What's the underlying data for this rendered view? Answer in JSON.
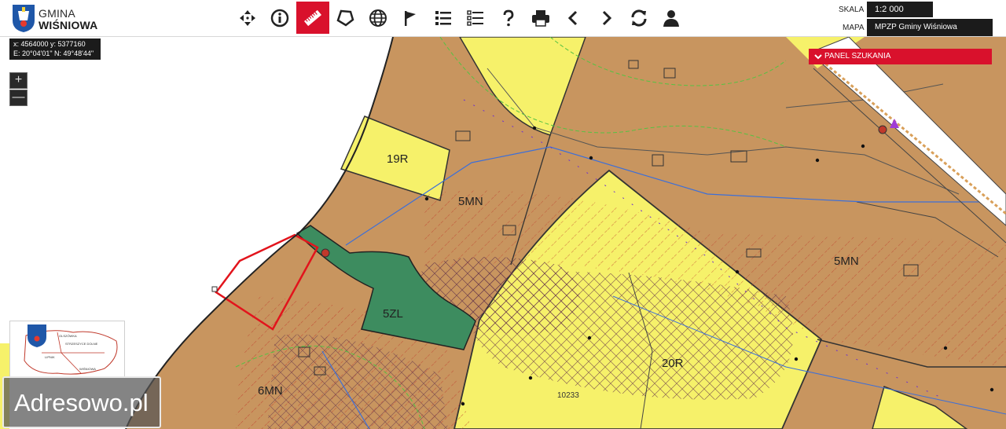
{
  "header": {
    "logo_line1": "GMINA",
    "logo_line2": "WIŚNIOWA",
    "scale_label": "SKALA",
    "scale_value": "1:2 000",
    "map_label": "MAPA",
    "map_value": "MPZP Gminy Wiśniowa"
  },
  "toolbar": {
    "tools": [
      {
        "icon": "pan-arrows-icon",
        "active": false
      },
      {
        "icon": "info-icon",
        "active": false
      },
      {
        "icon": "ruler-icon",
        "active": true
      },
      {
        "icon": "polygon-icon",
        "active": false
      },
      {
        "icon": "globe-icon",
        "active": false
      },
      {
        "icon": "flag-icon",
        "active": false
      },
      {
        "icon": "list-icon",
        "active": false
      },
      {
        "icon": "layers-list-icon",
        "active": false
      },
      {
        "icon": "help-icon",
        "active": false
      },
      {
        "icon": "print-icon",
        "active": false
      },
      {
        "icon": "back-icon",
        "active": false
      },
      {
        "icon": "forward-icon",
        "active": false
      },
      {
        "icon": "refresh-icon",
        "active": false
      },
      {
        "icon": "user-icon",
        "active": false
      }
    ]
  },
  "map": {
    "coords_line1": "x: 4564000 y: 5377160",
    "coords_line2": "E: 20°04'01\" N: 49°48'44\"",
    "zoom_in": "+",
    "zoom_out": "—",
    "panel_label": "PANEL SZUKANIA",
    "zones": [
      "19R",
      "5MN",
      "5MN",
      "5ZL",
      "20R",
      "6MN"
    ],
    "parcel_number": "10233",
    "colors": {
      "residential": "#c8955f",
      "agricultural": "#f6f16a",
      "forest": "#3d8c5f",
      "accent": "#d9112c"
    }
  },
  "minimap": {
    "places": [
      "OLSZÓWKA",
      "STRZESZYCE DOLNE",
      "LIPNIK",
      "WIŚNIOWA"
    ]
  },
  "watermark": "Adresowo.pl"
}
